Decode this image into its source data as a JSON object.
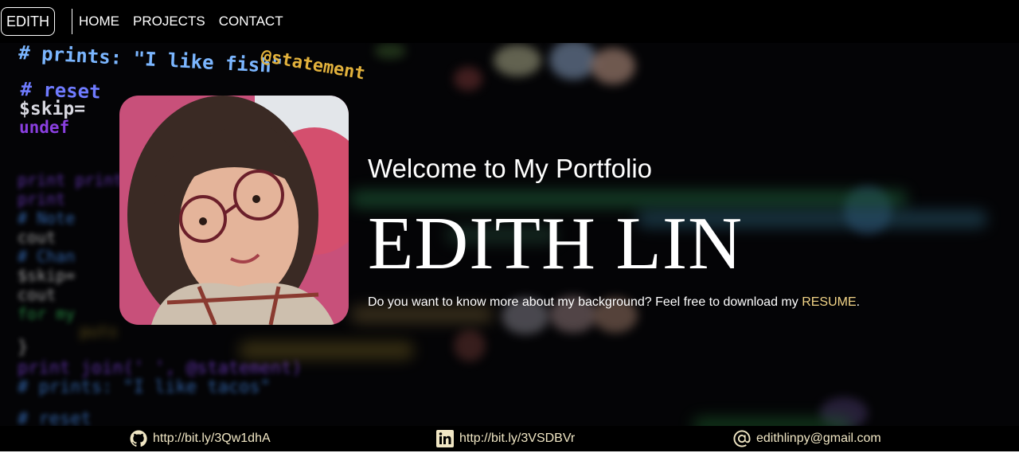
{
  "nav": {
    "brand": "EDITH",
    "links": [
      "HOME",
      "PROJECTS",
      "CONTACT"
    ]
  },
  "hero": {
    "welcome": "Welcome to My Portfolio",
    "name": "EDITH LIN",
    "tagline_prefix": "Do you want to know more about my background? Feel free to download my ",
    "resume_link": "RESUME",
    "tagline_suffix": "."
  },
  "background_code": {
    "line1": "# prints: \"I like fish\"",
    "line1_token": "@statement",
    "line2": "# reset",
    "line3": "$skip=",
    "line4": "undef"
  },
  "footer": {
    "github": {
      "icon": "github-icon",
      "text": "http://bit.ly/3Qw1dhA"
    },
    "linkedin": {
      "icon": "linkedin-icon",
      "text": "http://bit.ly/3VSDBVr"
    },
    "email": {
      "icon": "at-icon",
      "text": "edithlinpy@gmail.com"
    }
  },
  "colors": {
    "accent": "#f2d487",
    "footer_text": "#f0e6c4",
    "background": "#000000"
  }
}
